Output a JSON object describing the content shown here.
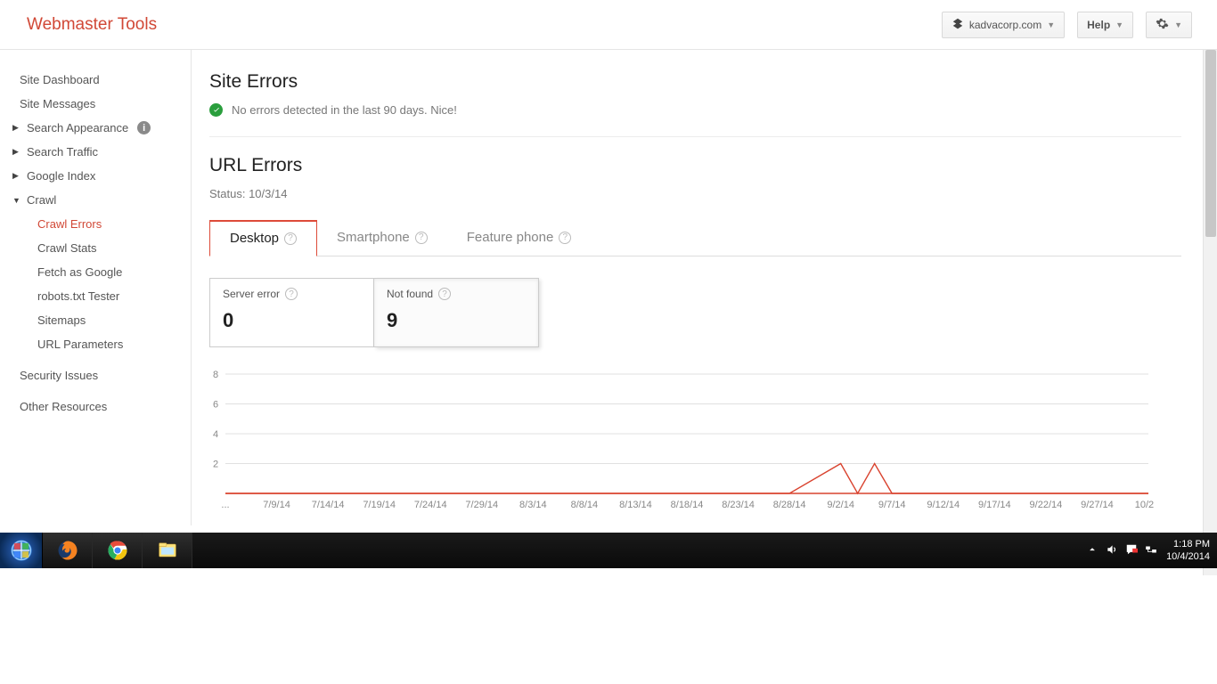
{
  "header": {
    "brand": "Webmaster Tools",
    "site_selector": "kadvacorp.com",
    "help_label": "Help"
  },
  "sidebar": {
    "site_dashboard": "Site Dashboard",
    "site_messages": "Site Messages",
    "search_appearance": "Search Appearance",
    "search_traffic": "Search Traffic",
    "google_index": "Google Index",
    "crawl": "Crawl",
    "crawl_items": {
      "crawl_errors": "Crawl Errors",
      "crawl_stats": "Crawl Stats",
      "fetch_as_google": "Fetch as Google",
      "robots_tester": "robots.txt Tester",
      "sitemaps": "Sitemaps",
      "url_parameters": "URL Parameters"
    },
    "security_issues": "Security Issues",
    "other_resources": "Other Resources"
  },
  "content": {
    "site_errors_title": "Site Errors",
    "site_errors_msg": "No errors detected in the last 90 days. Nice!",
    "url_errors_title": "URL Errors",
    "status_label": "Status: 10/3/14",
    "tabs": {
      "desktop": "Desktop",
      "smartphone": "Smartphone",
      "feature_phone": "Feature phone"
    },
    "cards": {
      "server_error_label": "Server error",
      "server_error_value": "0",
      "not_found_label": "Not found",
      "not_found_value": "9"
    }
  },
  "chart_data": {
    "type": "line",
    "title": "",
    "xlabel": "",
    "ylabel": "",
    "ylim": [
      0,
      8
    ],
    "y_ticks": [
      2,
      4,
      6,
      8
    ],
    "categories": [
      "...",
      "7/9/14",
      "7/14/14",
      "7/19/14",
      "7/24/14",
      "7/29/14",
      "8/3/14",
      "8/8/14",
      "8/13/14",
      "8/18/14",
      "8/23/14",
      "8/28/14",
      "9/2/14",
      "9/7/14",
      "9/12/14",
      "9/17/14",
      "9/22/14",
      "9/27/14",
      "10/2..."
    ],
    "series": [
      {
        "name": "Not found",
        "values": [
          0,
          0,
          0,
          0,
          0,
          0,
          0,
          0,
          0,
          0,
          0,
          0,
          2,
          0,
          0,
          0,
          0,
          0,
          0
        ],
        "extra_bump_between": [
          12,
          13
        ]
      }
    ]
  },
  "taskbar": {
    "time": "1:18 PM",
    "date": "10/4/2014"
  }
}
